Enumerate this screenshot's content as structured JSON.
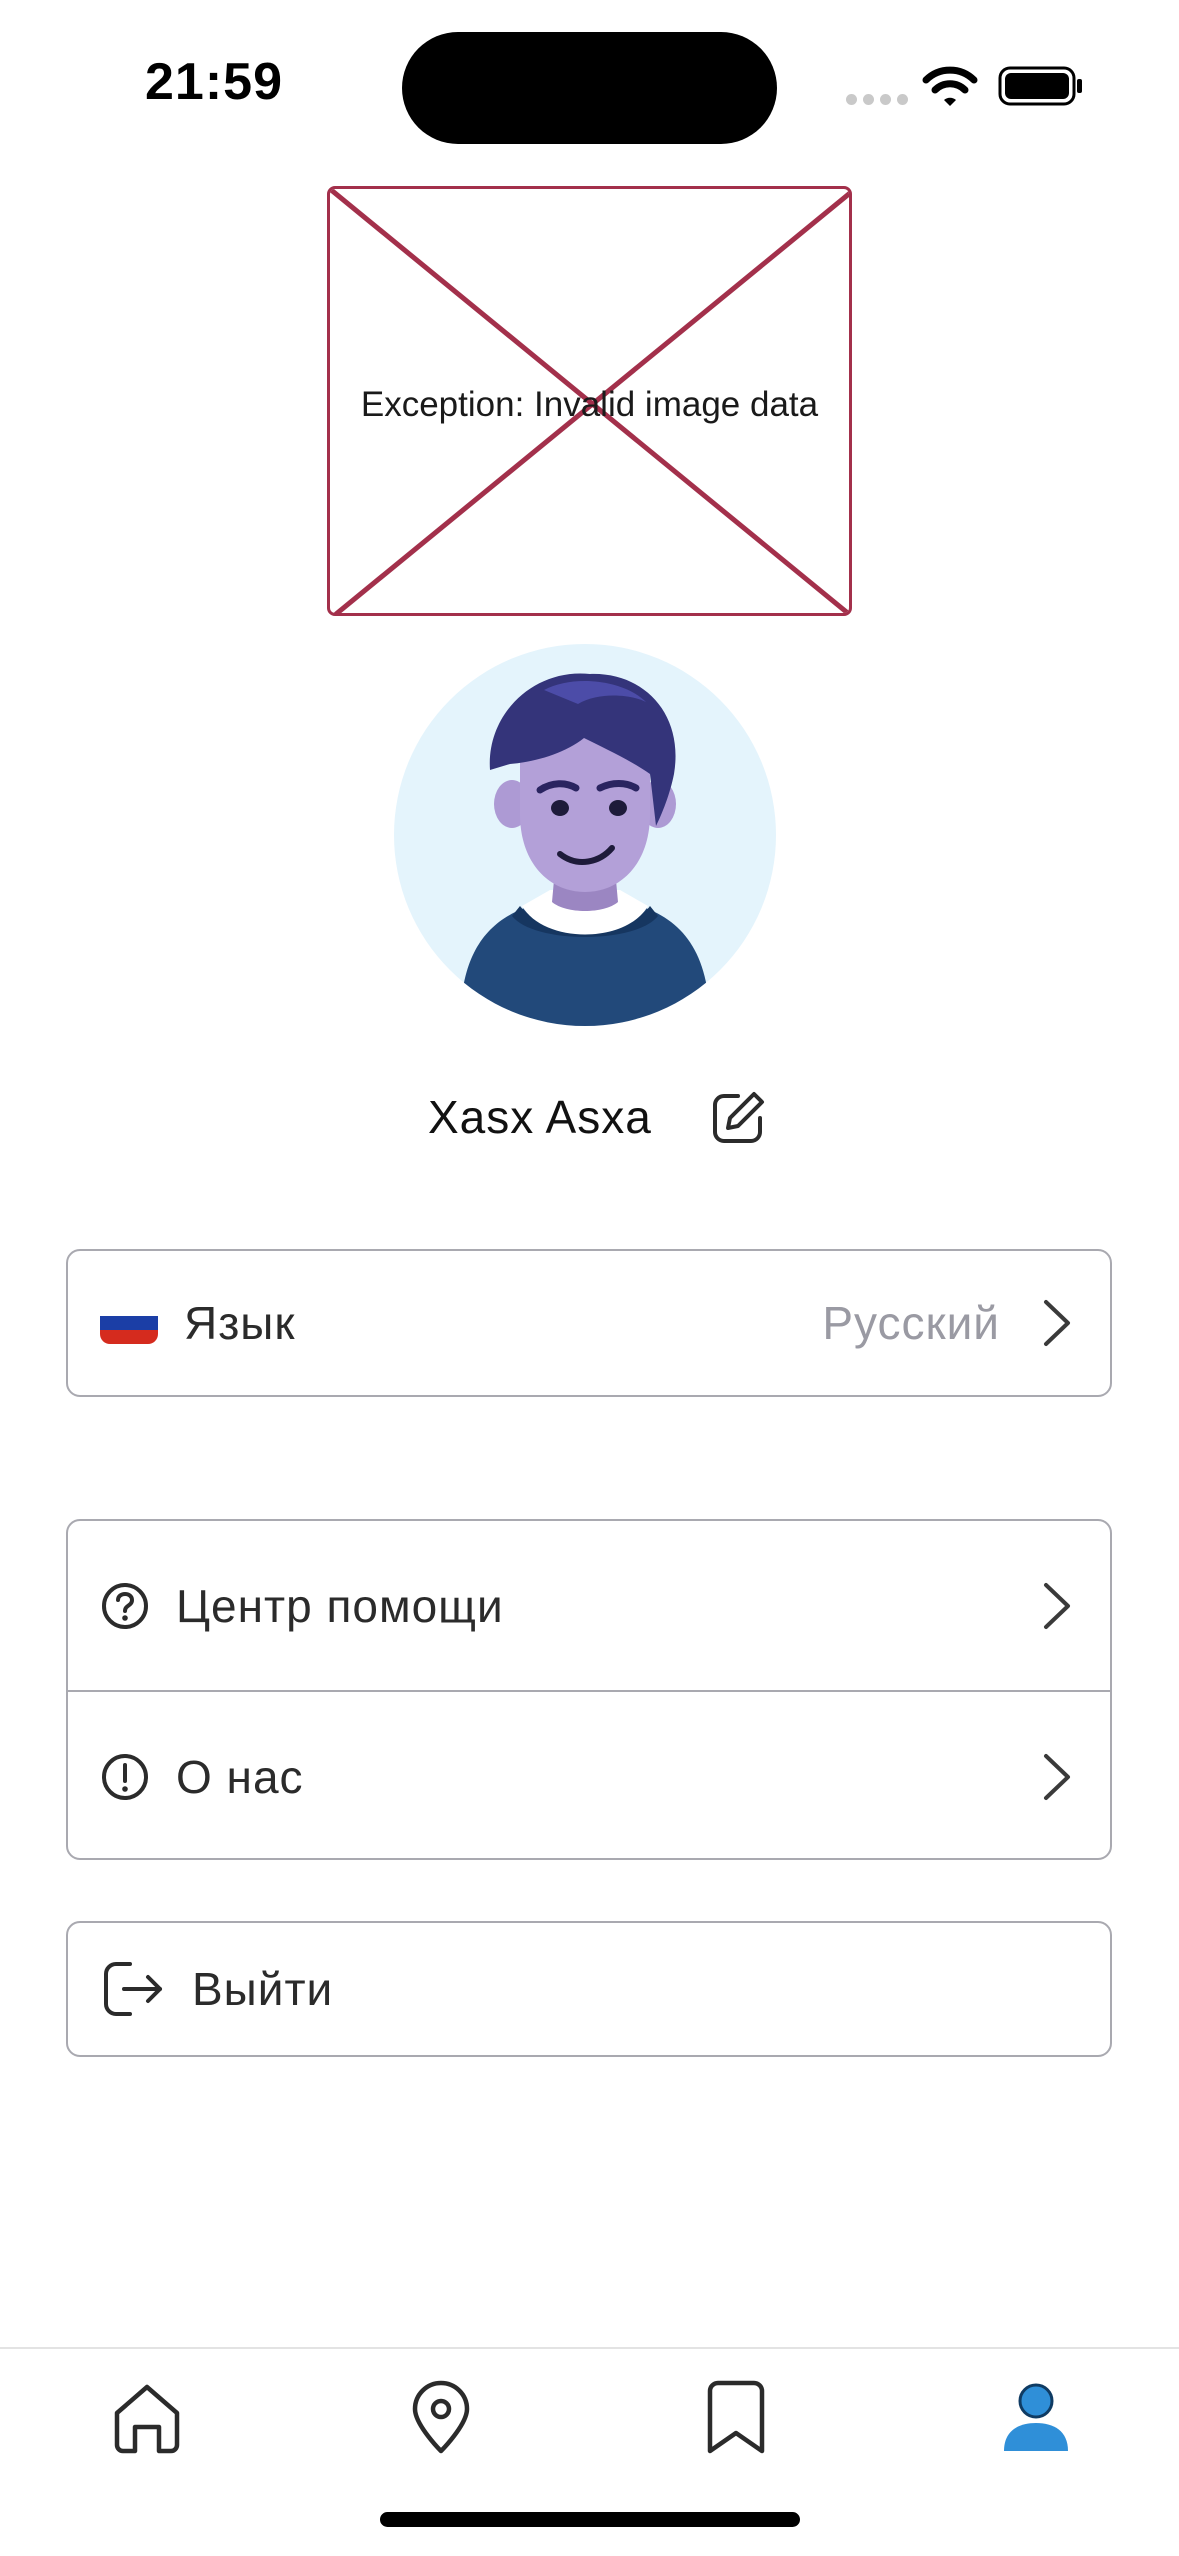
{
  "status_bar": {
    "time": "21:59"
  },
  "broken_image": {
    "text": "Exception: Invalid image data"
  },
  "profile": {
    "name": "Xasx Asxa"
  },
  "settings": {
    "language": {
      "label": "Язык",
      "value": "Русский"
    },
    "help_center": {
      "label": "Центр помощи"
    },
    "about": {
      "label": "О нас"
    },
    "logout": {
      "label": "Выйти"
    }
  },
  "tabbar": {
    "items": [
      {
        "icon": "home-icon",
        "active": false
      },
      {
        "icon": "location-pin-icon",
        "active": false
      },
      {
        "icon": "bookmark-icon",
        "active": false
      },
      {
        "icon": "profile-icon",
        "active": true
      }
    ]
  },
  "colors": {
    "accent": "#2f8fd8",
    "border": "#a9a9b0",
    "error_placeholder": "#a3304b",
    "avatar_bg": "#e4f4fc",
    "muted_text": "#9a9aa3"
  }
}
